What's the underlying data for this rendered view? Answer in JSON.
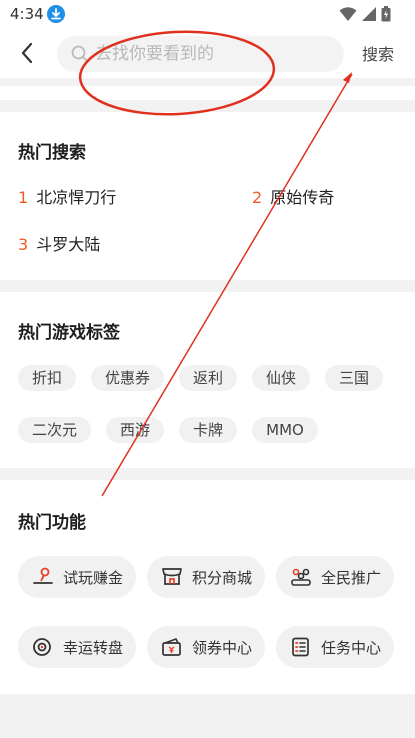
{
  "status": {
    "time": "4:34"
  },
  "header": {
    "search_placeholder": "去找你要看到的",
    "search_button": "搜索"
  },
  "hot_search": {
    "title": "热门搜索",
    "items": [
      {
        "rank": "1",
        "text": "北凉悍刀行"
      },
      {
        "rank": "2",
        "text": "原始传奇"
      },
      {
        "rank": "3",
        "text": "斗罗大陆"
      }
    ]
  },
  "game_tags": {
    "title": "热门游戏标签",
    "tags": [
      "折扣",
      "优惠券",
      "返利",
      "仙侠",
      "三国",
      "二次元",
      "西游",
      "卡牌",
      "MMO"
    ]
  },
  "functions": {
    "title": "热门功能",
    "items": [
      {
        "label": "试玩赚金",
        "icon": "joystick-icon"
      },
      {
        "label": "积分商城",
        "icon": "shop-icon"
      },
      {
        "label": "全民推广",
        "icon": "promote-icon"
      },
      {
        "label": "幸运转盘",
        "icon": "wheel-icon"
      },
      {
        "label": "领券中心",
        "icon": "coupon-icon"
      },
      {
        "label": "任务中心",
        "icon": "task-icon"
      }
    ]
  },
  "colors": {
    "rank": "#f15a24",
    "annotation": "#e0311f",
    "download_badge": "#1e90e8"
  }
}
